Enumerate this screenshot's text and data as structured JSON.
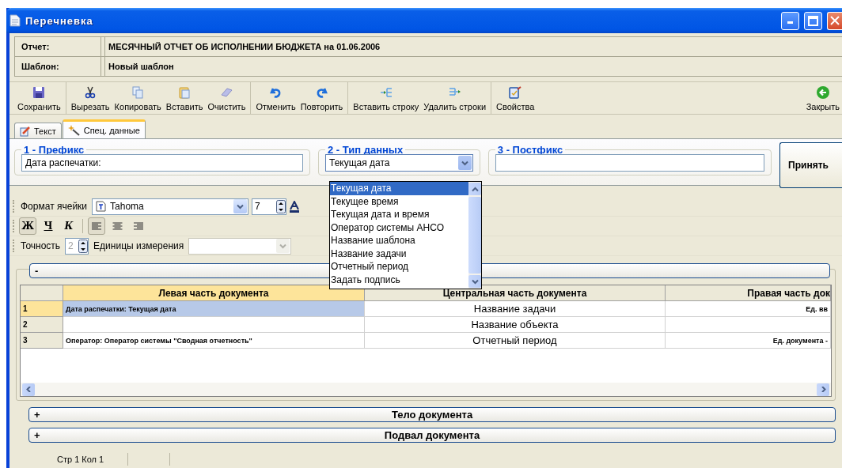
{
  "window": {
    "title": "Перечневка"
  },
  "info": [
    {
      "label": "Отчет:",
      "value": "МЕСЯЧНЫЙ ОТЧЕТ ОБ ИСПОЛНЕНИИ БЮДЖЕТА на 01.06.2006"
    },
    {
      "label": "Шаблон:",
      "value": "Новый шаблон"
    }
  ],
  "toolbar": {
    "groups": [
      [
        {
          "label": "Сохранить",
          "kind": "save"
        }
      ],
      [
        {
          "label": "Вырезать",
          "kind": "cut"
        },
        {
          "label": "Копировать",
          "kind": "copy"
        },
        {
          "label": "Вставить",
          "kind": "paste"
        },
        {
          "label": "Очистить",
          "kind": "clear"
        }
      ],
      [
        {
          "label": "Отменить",
          "kind": "undo"
        },
        {
          "label": "Повторить",
          "kind": "redo"
        }
      ],
      [
        {
          "label": "Вставить строку",
          "kind": "insert-row"
        },
        {
          "label": "Удалить строки",
          "kind": "delete-rows"
        }
      ],
      [
        {
          "label": "Свойства",
          "kind": "properties"
        }
      ]
    ],
    "close": {
      "label": "Закрыть",
      "kind": "close"
    }
  },
  "tabs": [
    {
      "label": "Текст",
      "kind": "text",
      "selected": false
    },
    {
      "label": "Спец. данные",
      "kind": "special",
      "selected": true
    }
  ],
  "special": {
    "prefix": {
      "legend": "1 - Префикс",
      "value": "Дата распечатки:"
    },
    "data_type": {
      "legend": "2 - Тип данных",
      "value": "Текущая дата",
      "expanded": true,
      "options": [
        {
          "label": "Текущая дата",
          "selected": true
        },
        {
          "label": "Текущее время",
          "selected": false
        },
        {
          "label": "Текущая дата и время",
          "selected": false
        },
        {
          "label": "Оператор системы АНСО",
          "selected": false
        },
        {
          "label": "Название шаблона",
          "selected": false
        },
        {
          "label": "Название задачи",
          "selected": false
        },
        {
          "label": "Отчетный период",
          "selected": false
        },
        {
          "label": "Задать подпись",
          "selected": false
        }
      ]
    },
    "postfix": {
      "legend": "3 - Постфикс"
    },
    "accept_button": "Принять"
  },
  "format": {
    "label": "Формат ячейки",
    "font": "Tahoma",
    "size": "7",
    "style_buttons": [
      {
        "label": "Ж",
        "kind": "bold",
        "pressed": true
      },
      {
        "label": "Ч",
        "kind": "underline",
        "pressed": false
      },
      {
        "label": "К",
        "kind": "italic",
        "pressed": false
      }
    ],
    "align_buttons": [
      {
        "kind": "left",
        "pressed": true
      },
      {
        "kind": "center",
        "pressed": false
      },
      {
        "kind": "right",
        "pressed": false
      }
    ],
    "precision_label": "Точность",
    "precision": {
      "value": "2",
      "disabled": true
    },
    "units_label": "Единицы измерения",
    "units": {
      "disabled": true
    }
  },
  "sections": [
    {
      "sign": "-",
      "expanded": true
    },
    {
      "sign": "+",
      "title": "Тело документа",
      "expanded": false
    },
    {
      "sign": "+",
      "title": "Подвал документа",
      "expanded": false
    }
  ],
  "table": {
    "columns": [
      {
        "title": "Левая часть документа",
        "selected": true
      },
      {
        "title": "Центральная часть документа",
        "selected": false
      },
      {
        "title": "Правая часть док",
        "selected": false
      }
    ],
    "rows": [
      {
        "number": "1",
        "selected": true,
        "cells": [
          {
            "text": "Дата распечатки: Текущая дата",
            "selected": true
          },
          {
            "text": "Название задачи",
            "selected": false
          },
          {
            "text": "Ед. вв",
            "selected": false
          }
        ]
      },
      {
        "number": "2",
        "selected": false,
        "cells": [
          {
            "selected": false
          },
          {
            "text": "Название объекта",
            "selected": false
          },
          {
            "selected": false
          }
        ]
      },
      {
        "number": "3",
        "selected": false,
        "cells": [
          {
            "text": "Оператор: Оператор системы \"Сводная отчетность\"",
            "selected": false
          },
          {
            "text": "Отчетный период",
            "selected": false
          },
          {
            "text": "Ед. документа -",
            "selected": false
          }
        ]
      }
    ]
  },
  "status_bar": {
    "position": "Стр 1 Кол 1"
  }
}
